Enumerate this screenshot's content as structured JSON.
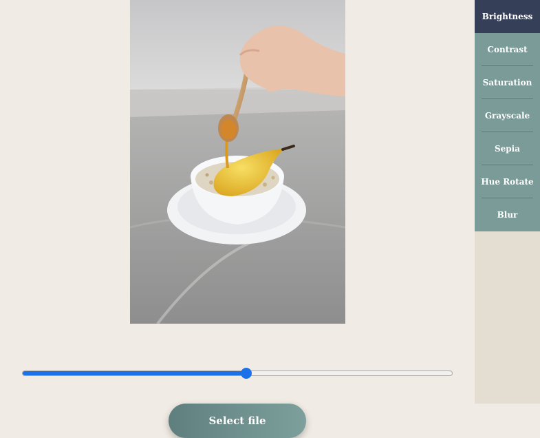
{
  "filters": {
    "items": [
      {
        "label": "Brightness",
        "active": true
      },
      {
        "label": "Contrast",
        "active": false
      },
      {
        "label": "Saturation",
        "active": false
      },
      {
        "label": "Grayscale",
        "active": false
      },
      {
        "label": "Sepia",
        "active": false
      },
      {
        "label": "Hue Rotate",
        "active": false
      },
      {
        "label": "Blur",
        "active": false
      }
    ]
  },
  "slider": {
    "value": 0.52
  },
  "actions": {
    "select_file_label": "Select file"
  },
  "colors": {
    "background": "#f0ebe4",
    "sidebar_bg": "#e4ddd1",
    "filter_item": "#7a9b97",
    "filter_active": "#363f58",
    "slider_accent": "#1b72e8"
  }
}
